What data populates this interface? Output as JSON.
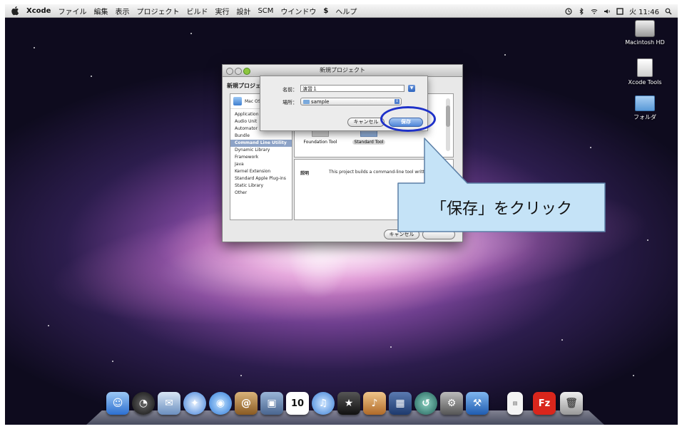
{
  "menubar": {
    "app_name": "Xcode",
    "items": [
      "ファイル",
      "編集",
      "表示",
      "プロジェクト",
      "ビルド",
      "実行",
      "設計",
      "SCM",
      "ウインドウ",
      "ヘルプ"
    ],
    "clock": "火 11:46"
  },
  "desktop": {
    "icons": [
      {
        "label": "Macintosh HD",
        "icon": "hard-drive-icon"
      },
      {
        "label": "Xcode Tools",
        "icon": "disk-icon"
      },
      {
        "label": "フォルダ",
        "icon": "folder-icon"
      }
    ]
  },
  "project_window": {
    "title": "新規プロジェクト",
    "heading": "新規プロジェ",
    "mac_label": "Mac OS X",
    "list_items": [
      "Application",
      "Audio Unit",
      "Automator",
      "Bundle",
      "Command Line Utility",
      "Dynamic Library",
      "Framework",
      "Java",
      "Kernel Extension",
      "Standard Apple Plug-ins",
      "Static Library",
      "Other"
    ],
    "selected_item": "Command Line Utility",
    "templates": [
      "Foundation Tool",
      "Standard Tool"
    ],
    "description_label": "説明",
    "description_text": "This project builds a command-line tool writt",
    "cancel_label": "キャンセル"
  },
  "save_sheet": {
    "name_label": "名前：",
    "name_value": "演習１",
    "location_label": "場所：",
    "location_value": "sample",
    "cancel_label": "キャンセル",
    "save_label": "保存"
  },
  "callout": {
    "text": "「保存」をクリック",
    "color": "#c5e3f7",
    "highlight_color": "#1e31c9"
  },
  "dock": {
    "apps": [
      "finder-icon",
      "dashboard-icon",
      "mail-icon",
      "safari-icon",
      "ichat-icon",
      "address-book-icon",
      "iphoto-icon",
      "ical-icon",
      "itunes-icon",
      "imovie-icon",
      "garageband-icon",
      "spaces-icon",
      "time-machine-icon",
      "system-preferences-icon",
      "xcode-icon",
      "document-icon",
      "filezilla-icon",
      "trash-icon"
    ],
    "ical_day": "10",
    "filezilla_letter": "Fz"
  }
}
